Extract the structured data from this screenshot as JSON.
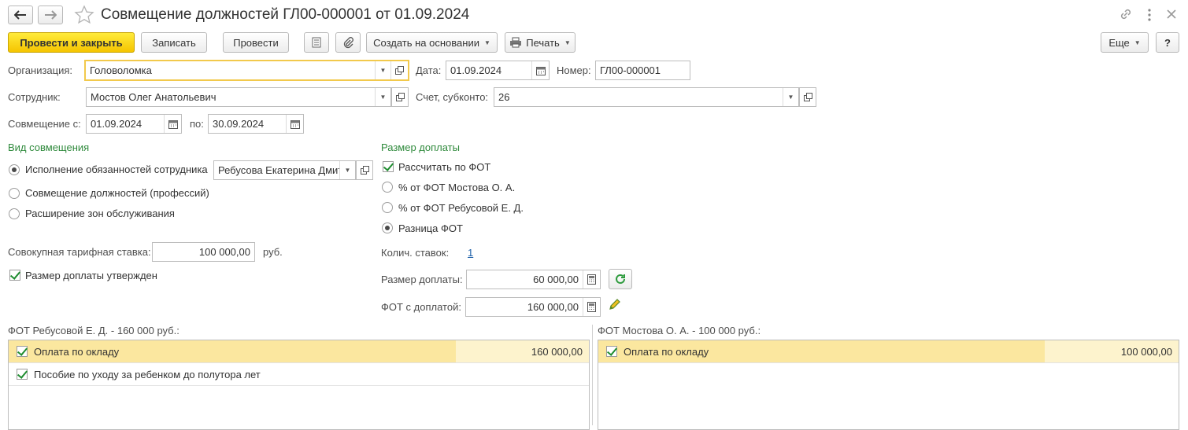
{
  "window": {
    "title": "Совмещение должностей ГЛ00-000001 от 01.09.2024"
  },
  "toolbar": {
    "post_close": "Провести и закрыть",
    "save": "Записать",
    "post": "Провести",
    "create_based": "Создать на основании",
    "print": "Печать",
    "more": "Еще",
    "help": "?"
  },
  "form": {
    "org_label": "Организация:",
    "org_value": "Головоломка",
    "date_label": "Дата:",
    "date_value": "01.09.2024",
    "number_label": "Номер:",
    "number_value": "ГЛ00-000001",
    "employee_label": "Сотрудник:",
    "employee_value": "Мостов Олег Анатольевич",
    "account_label": "Счет, субконто:",
    "account_value": "26",
    "from_label": "Совмещение с:",
    "from_value": "01.09.2024",
    "to_label": "по:",
    "to_value": "30.09.2024"
  },
  "kind": {
    "title": "Вид совмещения",
    "options": [
      "Исполнение обязанностей сотрудника",
      "Совмещение должностей (профессий)",
      "Расширение зон обслуживания"
    ],
    "selected_index": 0,
    "employee_value": "Ребусова Екатерина Дмит"
  },
  "rate": {
    "label": "Совокупная тарифная ставка:",
    "value": "100 000,00",
    "unit": "руб.",
    "approved_label": "Размер доплаты утвержден",
    "approved": true
  },
  "surcharge": {
    "title": "Размер доплаты",
    "calc_label": "Рассчитать по ФОТ",
    "calc_checked": true,
    "options": [
      "% от ФОТ Мостова О. А.",
      "% от ФОТ Ребусовой Е. Д.",
      "Разница ФОТ"
    ],
    "selected_index": 2,
    "count_label": "Колич. ставок:",
    "count_value": "1",
    "amount_label": "Размер доплаты:",
    "amount_value": "60 000,00",
    "fot_label": "ФОТ с доплатой:",
    "fot_value": "160 000,00"
  },
  "left_table": {
    "title": "ФОТ Ребусовой Е. Д. - 160 000 руб.:",
    "rows": [
      {
        "name": "Оплата по окладу",
        "amount": "160 000,00",
        "checked": true
      },
      {
        "name": "Пособие по уходу за ребенком до полутора лет",
        "amount": "",
        "checked": true
      }
    ]
  },
  "right_table": {
    "title": "ФОТ Мостова О. А. - 100 000 руб.:",
    "rows": [
      {
        "name": "Оплата по окладу",
        "amount": "100 000,00",
        "checked": true
      }
    ]
  },
  "colors": {
    "accent_yellow": "#f5c400",
    "section_green": "#2f8a3c",
    "row_selected": "#fbe79f",
    "link_blue": "#1c5fa8"
  },
  "icons": [
    "back-arrow-icon",
    "forward-arrow-icon",
    "star-icon",
    "link-icon",
    "kebab-menu-icon",
    "close-icon",
    "document-list-icon",
    "paperclip-icon",
    "printer-icon",
    "calendar-icon",
    "open-icon",
    "refresh-icon",
    "pencil-icon"
  ]
}
